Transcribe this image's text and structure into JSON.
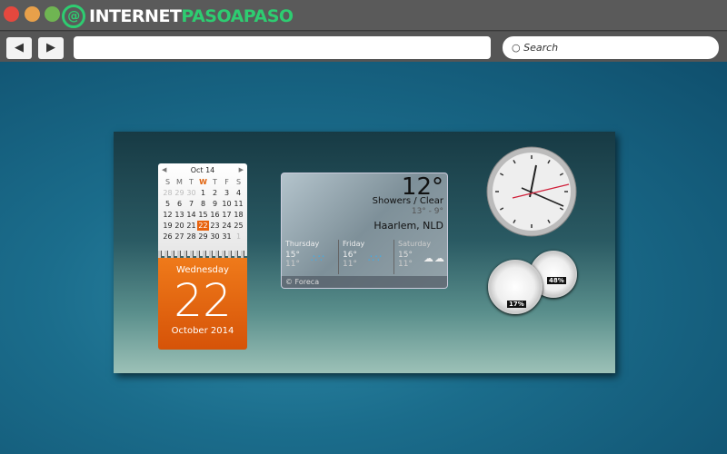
{
  "window": {
    "controls": [
      {
        "name": "close",
        "color": "#e5483e"
      },
      {
        "name": "minimize",
        "color": "#e8a04a"
      },
      {
        "name": "maximize",
        "color": "#6fb552"
      }
    ],
    "logo": {
      "part1": "INTERNET",
      "part2": "PASOAPASO",
      "brand_color": "#2ecc71"
    }
  },
  "toolbar": {
    "back": "◀",
    "forward": "▶",
    "url": "",
    "search_placeholder": "Search"
  },
  "calendar": {
    "month_label": "Oct 14",
    "weekdays": [
      "S",
      "M",
      "T",
      "W",
      "T",
      "F",
      "S"
    ],
    "days": [
      [
        "28",
        "29",
        "30",
        "1",
        "2",
        "3",
        "4"
      ],
      [
        "5",
        "6",
        "7",
        "8",
        "9",
        "10",
        "11"
      ],
      [
        "12",
        "13",
        "14",
        "15",
        "16",
        "17",
        "18"
      ],
      [
        "19",
        "20",
        "21",
        "22",
        "23",
        "24",
        "25"
      ],
      [
        "26",
        "27",
        "28",
        "29",
        "30",
        "31",
        "1"
      ]
    ],
    "weekday_name": "Wednesday",
    "day": "22",
    "month_year": "October 2014",
    "accent": "#e8630f"
  },
  "weather": {
    "temp": "12°",
    "condition": "Showers / Clear",
    "high_low": "13° - 9°",
    "city": "Haarlem, NLD",
    "forecast": [
      {
        "day": "Thursday",
        "hi": "15°",
        "lo": "11°",
        "icon": "rain-icon"
      },
      {
        "day": "Friday",
        "hi": "16°",
        "lo": "11°",
        "icon": "rain-icon"
      },
      {
        "day": "Saturday",
        "hi": "15°",
        "lo": "11°",
        "icon": "cloud-icon"
      }
    ],
    "credit": "© Foreca"
  },
  "meters": {
    "cpu": "17%",
    "memory": "48%"
  }
}
